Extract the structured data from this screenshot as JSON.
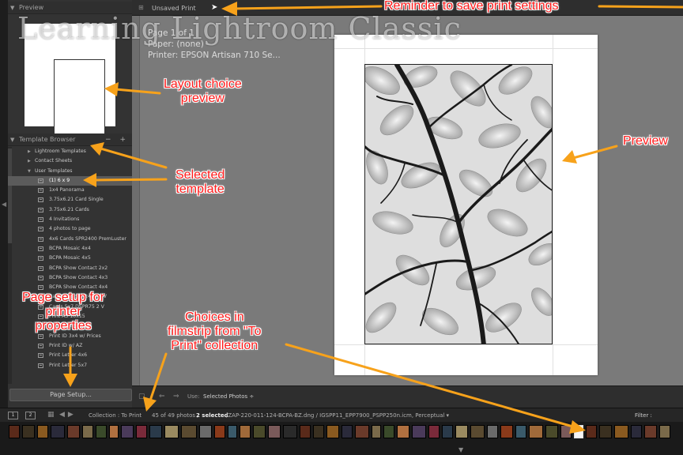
{
  "left_panel": {
    "preview_title": "Preview",
    "template_browser_title": "Template Browser",
    "template_controls": "− +",
    "folders": [
      "Lightroom Templates",
      "Contact Sheets",
      "User Templates"
    ],
    "templates": [
      "(1) 6 x 9",
      "1x4 Panorama",
      "3.75x6.21 Card Single",
      "3.75x6.21 Cards",
      "4 Invitations",
      "4 photos to page",
      "4x6 Cards SPR2400 PremLuster",
      "BCPA Mosaic 4x4",
      "BCPA Mosaic 4x5",
      "BCPA Show Contact 2x2",
      "BCPA Show Contact 4x3",
      "BCPA Show Contact 4x4",
      "Cards 4x6 SPR2400 4 V",
      "Cards 5x7 DSPR75 2 V",
      "Print A3 10x15",
      "Print ID 3x4",
      "Print ID 3x4 w/ Prices",
      "Print ID w/ AZ",
      "Print Letter 4x6",
      "Print Letter 5x7"
    ],
    "page_setup_label": "Page Setup..."
  },
  "toolbar": {
    "unsaved_label": "Unsaved Print"
  },
  "overlay": {
    "page_line": "Page 1 of 1",
    "paper_line": "Paper: (none)",
    "printer_line": "Printer: EPSON Artisan 710 Se..."
  },
  "bottom_toolbar": {
    "use_label": "Use:",
    "use_value": "Selected Photos ÷"
  },
  "filmstrip_bar": {
    "view1": "1",
    "view2": "2",
    "collection": "Collection : To Print",
    "count": "45 of 49 photos /",
    "selected": "2 selected",
    "path": "/ZAP-220-011-124-BCPA-BZ.dng / IGSPP11_EPP7900_PSPP250n.icm, Perceptual ▾",
    "filter_label": "Filter :"
  },
  "watermark": "Learning Lightroom Classic",
  "annotations": {
    "reminder": "Reminder to save print settings",
    "layout_preview": [
      "Layout choice",
      "preview"
    ],
    "selected_template": [
      "Selected",
      "template"
    ],
    "preview": "Preview",
    "page_setup": [
      "Page setup for",
      "printer",
      "properties"
    ],
    "filmstrip_choices": [
      "Choices in",
      "filmstrip from \"To",
      "Print\" collection"
    ]
  },
  "colors": {
    "annotation_text": "#ff1a1a",
    "annotation_arrow": "#f7a21b",
    "panel_bg": "#333333",
    "work_area": "#7a7a7a",
    "selected_row": "#5b5b5b"
  }
}
